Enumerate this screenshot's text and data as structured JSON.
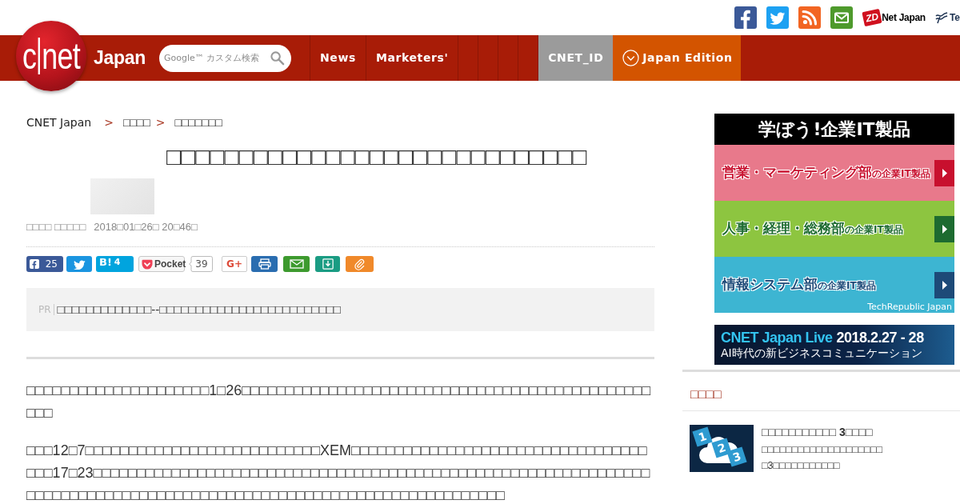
{
  "header": {
    "partners": [
      {
        "kind": "zdnet",
        "badge": "ZD",
        "name": "Net Japan"
      },
      {
        "kind": "techrepublic",
        "name": "Te"
      }
    ],
    "logo": {
      "letters": [
        "c",
        "net"
      ],
      "wordmark": "Japan"
    },
    "search": {
      "placeholder": "Google™ カスタム検索"
    },
    "nav": [
      {
        "label": "News",
        "kind": "section"
      },
      {
        "label": "Marketers'",
        "kind": "section"
      },
      {
        "label": "CNET_ID",
        "kind": "account"
      },
      {
        "label": "Japan Edition",
        "kind": "edition"
      }
    ]
  },
  "breadcrumb": [
    {
      "label": "CNET Japan",
      "kind": "link"
    },
    {
      "label": ">",
      "kind": "separator"
    },
    {
      "label": "□□□□",
      "kind": "link"
    },
    {
      "label": ">",
      "kind": "separator"
    },
    {
      "label": "□□□□□□□",
      "kind": "link"
    }
  ],
  "article": {
    "title": "□□□□□□□□□□□□□□□□□□□□□□□□□□□□□",
    "author": "□□□□ □□□□□",
    "date": "2018□01□26□ 20□46□",
    "share": [
      {
        "kind": "facebook",
        "count": "25"
      },
      {
        "kind": "twitter"
      },
      {
        "kind": "hatena",
        "label": "B!",
        "count": "4"
      },
      {
        "kind": "pocket",
        "label": "Pocket",
        "count": "39"
      },
      {
        "kind": "gplus",
        "label": "G+"
      },
      {
        "kind": "print"
      },
      {
        "kind": "mail"
      },
      {
        "kind": "download"
      },
      {
        "kind": "clip"
      }
    ],
    "pr": {
      "tag": "PR",
      "text": "□□□□□□□□□□□□□--□□□□□□□□□□□□□□□□□□□□□□□□□"
    },
    "paragraphs": [
      "□□□□□□□□□□□□□□□□□□□□□1□26□□□□□□□□□□□□□□□□□□□□□□□□□□□□□□□□□□□□□□□□□□□□□□□□□□",
      "□□□12□7□□□□□□□□□□□□□□□□□□□□□□□□□□□XEM□□□□□□□□□□□□□□□□□□□□□□□□□□□□□□□□□□□□□17□23□□□□□□□□□□□□□□□□□□□□□□□□□□□□□□□□□□□□□□□□□□□□□□□□□□□□□□□□□□□□□□□□□□□□□□□□□□□□□□□□□□□□□□□□□□□□□□□□□□□□□□□□□□□□□□□□□□□□□□□"
    ]
  },
  "sidebar": {
    "learn_banner": {
      "title": "学ぼう!企業IT製品",
      "rows": [
        {
          "label": "営業・マーケティング部",
          "suffix": "の企業IT製品",
          "color": "#e8798b"
        },
        {
          "label": "人事・経理・総務部",
          "suffix": "の企業IT製品",
          "color": "#8dc540"
        },
        {
          "label": "情報システム部",
          "suffix": "の企業IT製品",
          "color": "#3db5d2"
        }
      ],
      "credit": "TechRepublic Japan"
    },
    "event_banner": {
      "name": "CNET Japan Live",
      "dates": "2018.2.27 - 28",
      "subtitle": "AI時代の新ビジネスコミュニケーション"
    },
    "ranking": {
      "heading": "□□□□",
      "items": [
        {
          "title": "□□□□□□□□□□□ 3□□□□",
          "description": "□□□□□□□□□□□□□□□□□□□□□3□□□□□□□□□□□",
          "tiles": [
            "1",
            "2",
            "3"
          ]
        }
      ]
    }
  }
}
